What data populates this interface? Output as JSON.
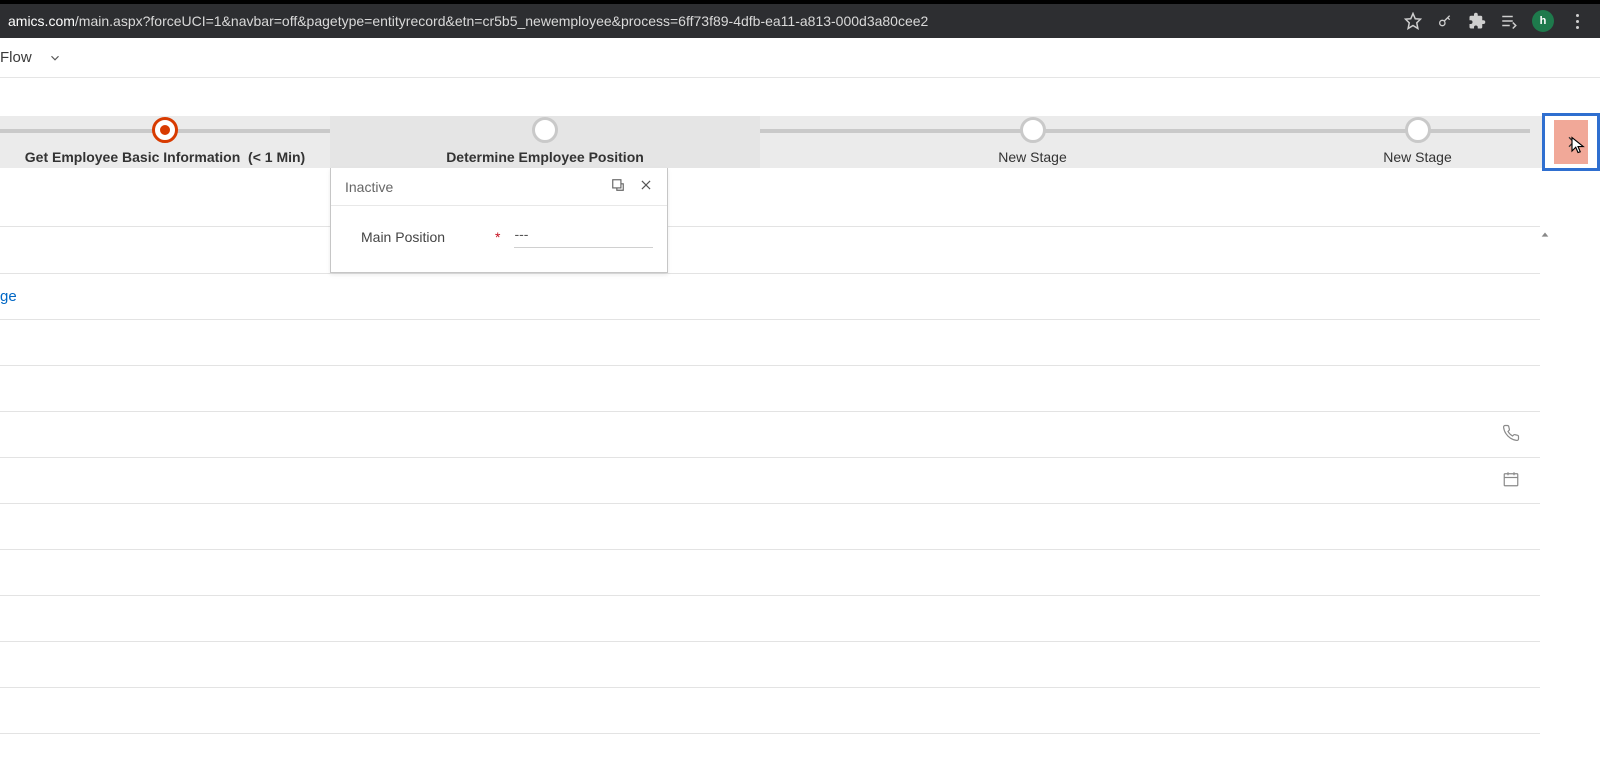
{
  "browser": {
    "domain": "amics.com",
    "path": "/main.aspx?forceUCI=1&navbar=off&pagetype=entityrecord&etn=cr5b5_newemployee&process=6ff73f89-4dfb-ea11-a813-000d3a80cee2",
    "avatar_initial": "h"
  },
  "commandbar": {
    "flow_label": "Flow"
  },
  "bpf": {
    "stages": [
      {
        "label": "Get Employee Basic Information",
        "duration": "(< 1 Min)"
      },
      {
        "label": "Determine Employee Position"
      },
      {
        "label": "New Stage"
      },
      {
        "label": "New Stage"
      }
    ],
    "flyout": {
      "status": "Inactive",
      "field_label": "Main Position",
      "required_mark": "*",
      "field_value": "---"
    }
  },
  "form": {
    "link_fragment": "ge"
  }
}
